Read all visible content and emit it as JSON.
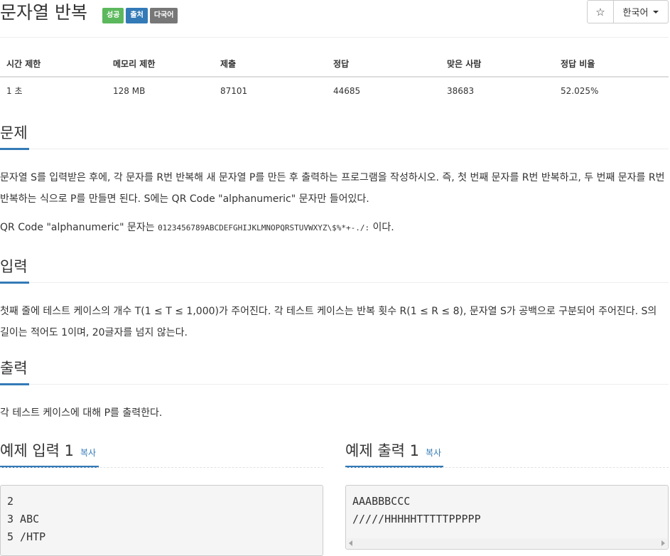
{
  "problem": {
    "title": "문자열 반복",
    "labels": [
      "성공",
      "출처",
      "다국어"
    ]
  },
  "toolbar": {
    "star_icon": "star-outline-icon",
    "star_glyph": "☆",
    "language": "한국어"
  },
  "info_table": {
    "headers": [
      "시간 제한",
      "메모리 제한",
      "제출",
      "정답",
      "맞은 사람",
      "정답 비율"
    ],
    "row": [
      "1 초",
      "128 MB",
      "87101",
      "44685",
      "38683",
      "52.025%"
    ]
  },
  "sections": {
    "description": {
      "heading": "문제",
      "para1": "문자열 S를 입력받은 후에, 각 문자를 R번 반복해 새 문자열 P를 만든 후 출력하는 프로그램을 작성하시오. 즉, 첫 번째 문자를 R번 반복하고, 두 번째 문자를 R번 반복하는 식으로 P를 만들면 된다. S에는 QR Code \"alphanumeric\" 문자만 들어있다.",
      "para2_prefix": "QR Code \"alphanumeric\" 문자는",
      "para2_code": "0123456789ABCDEFGHIJKLMNOPQRSTUVWXYZ\\$%*+-./:",
      "para2_suffix": "이다."
    },
    "input": {
      "heading": "입력",
      "para": "첫째 줄에 테스트 케이스의 개수 T(1 ≤ T ≤ 1,000)가 주어진다. 각 테스트 케이스는 반복 횟수 R(1 ≤ R ≤ 8), 문자열 S가 공백으로 구분되어 주어진다. S의 길이는 적어도 1이며, 20글자를 넘지 않는다."
    },
    "output": {
      "heading": "출력",
      "para": "각 테스트 케이스에 대해 P를 출력한다."
    }
  },
  "samples": {
    "input": {
      "heading": "예제 입력 1",
      "copy": "복사",
      "lines": [
        "2",
        "3 ABC",
        "5 /HTP"
      ]
    },
    "output": {
      "heading": "예제 출력 1",
      "copy": "복사",
      "lines": [
        "AAABBBCCC",
        "/////HHHHHTTTTTPPPPP"
      ]
    }
  },
  "colors": {
    "success": "#5cb85c",
    "info": "#337ab7",
    "gray": "#777777",
    "accent": "#337ab7"
  }
}
